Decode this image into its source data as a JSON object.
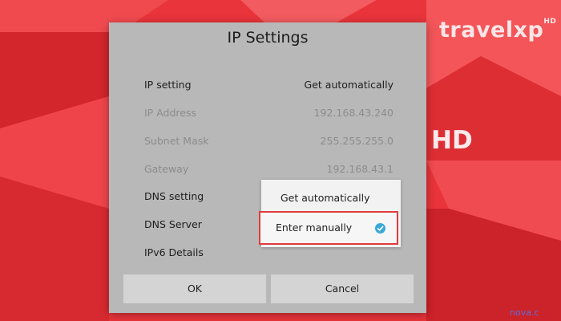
{
  "branding": {
    "channel_logo": "travelxp",
    "logo_suffix": "HD",
    "hd_badge": "HD",
    "bottom_watermark": "nova.c"
  },
  "dialog": {
    "title": "IP Settings",
    "rows": [
      {
        "label": "IP setting",
        "value": "Get automatically",
        "enabled": true
      },
      {
        "label": "IP Address",
        "value": "192.168.43.240",
        "enabled": false
      },
      {
        "label": "Subnet Mask",
        "value": "255.255.255.0",
        "enabled": false
      },
      {
        "label": "Gateway",
        "value": "192.168.43.1",
        "enabled": false
      },
      {
        "label": "DNS setting",
        "value": "",
        "enabled": true
      },
      {
        "label": "DNS Server",
        "value": "",
        "enabled": true
      },
      {
        "label": "IPv6 Details",
        "value": "",
        "enabled": true
      }
    ],
    "dns_dropdown": {
      "options": [
        "Get automatically",
        "Enter manually"
      ],
      "selected": "Enter manually",
      "check_icon": "check-circle-icon"
    },
    "buttons": {
      "ok_label": "OK",
      "cancel_label": "Cancel"
    }
  },
  "colors": {
    "background_red": "#e8343a",
    "dialog_gray": "#b8b8b8",
    "highlight_border": "#e03c3c",
    "check_blue": "#3aa8d8"
  }
}
